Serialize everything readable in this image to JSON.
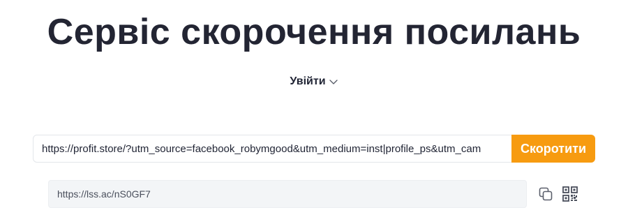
{
  "header": {
    "title": "Сервіс скорочення посилань"
  },
  "auth": {
    "login_label": "Увійти",
    "login_icon": "chevron-down-icon"
  },
  "shortener": {
    "url_value": "https://profit.store/?utm_source=facebook_robymgood&utm_medium=inst|profile_ps&utm_cam",
    "submit_label": "Скоротити",
    "accent_color": "#f79b10"
  },
  "result": {
    "short_url": "https://lss.ac/nS0GF7",
    "copy_icon": "copy-icon",
    "qr_icon": "qr-code-icon"
  }
}
